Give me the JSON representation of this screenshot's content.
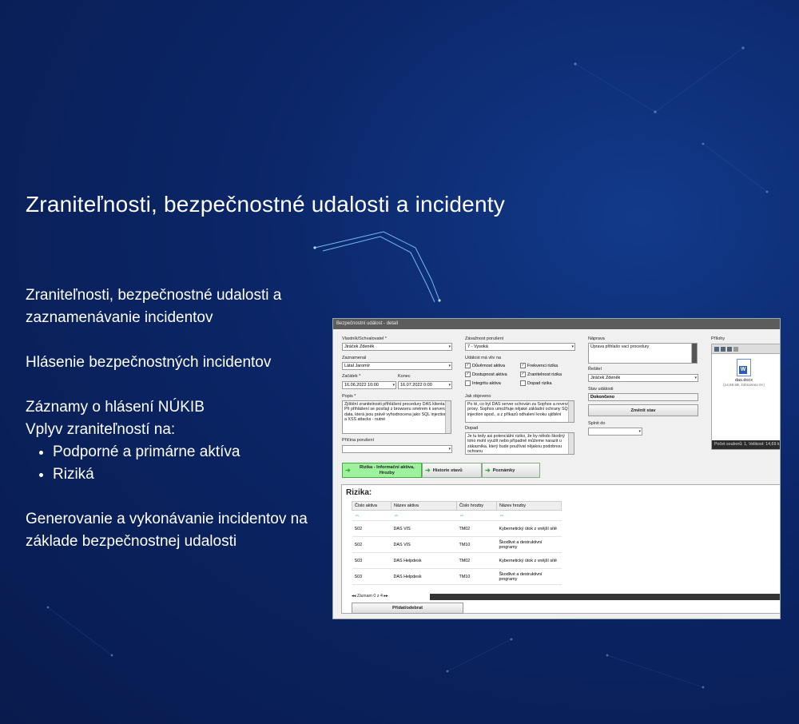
{
  "headline": "Zraniteľnosti, bezpečnostné udalosti a incidenty",
  "bullets": {
    "p1": "Zraniteľnosti, bezpečnostné udalosti a zaznamenávanie incidentov",
    "p2": "Hlásenie bezpečnostných incidentov",
    "p3a": "Záznamy o hlásení NÚKIB",
    "p3b": "Vplyv zraniteľností na:",
    "list": [
      "Podporné a primárne aktíva",
      "Riziká"
    ],
    "p4": "Generovanie a vykonávanie incidentov na základe bezpečnostnej udalosti"
  },
  "screenshot": {
    "window_title": "Bezpečnostní událost - detail",
    "col1": {
      "owner_label": "Vlastník/Schvalovatel *",
      "owner_value": "Jiráček Zdeněk",
      "recorder_label": "Zaznamenal",
      "recorder_value": "Látal Jaromír",
      "start_label": "Začátek *",
      "start_value": "16.06.2022 10:00",
      "end_label": "Konec",
      "end_value": "16.07.2022 0:00",
      "desc_label": "Popis *",
      "desc_text": "Zjištění zranitelnosti přihlášení procedury DAS klienta. Při přihlášení se posílají z browseru směrem k serveru data, která jsou právě vyhodnocena jako SQL injection a XSS attacks - nutné",
      "cause_label": "Příčina porušení",
      "cause_value": ""
    },
    "col2": {
      "severity_label": "Závažnost porušení",
      "severity_value": "7 - Vysoká",
      "impact_label": "Událost má vliv na",
      "checks": [
        {
          "label": "Důvěrnost aktiva",
          "checked": true
        },
        {
          "label": "Frekvenci rizika",
          "checked": true
        },
        {
          "label": "Dostupnost aktiva",
          "checked": true
        },
        {
          "label": "Zranitelnost rizika",
          "checked": true
        },
        {
          "label": "Integritu aktiva",
          "checked": false
        },
        {
          "label": "Dopad rizika",
          "checked": false
        }
      ],
      "found_label": "Jak objeveno",
      "found_text": "Po té, co byl DAS server schován za Sophos a reverzní proxy. Sophos umožňuje nějaké základní ochrany SQL injection apod., a z příkazů odhalení kroku ujištění",
      "impact2_label": "Dopad",
      "impact2_text": "Je tu tedy asi potenciální riziko, že by někdo škodný toho mohl využít nebo případně můžeme narazit u zákazníka, který bude používat nějakou podobnou ochranu"
    },
    "col3": {
      "remedy_label": "Náprava",
      "remedy_text": "Úprava přihlašo vací procedury",
      "solver_label": "Řešitel",
      "solver_value": "Jiráček Zdeněk",
      "state_label": "Stav události",
      "state_value": "Dokončeno",
      "change_state_btn": "Změnit stav",
      "fulfil_label": "Splnit do",
      "fulfil_value": ""
    },
    "attachments": {
      "label": "Přílohy",
      "file_name": "das.docx",
      "file_info": "(14,69 kB, zobrazeno 0×)",
      "footer": "Počet souborů: 1, Velikost: 14,69 kB"
    },
    "tabs": [
      "Rizika - Informační aktiva, Hrozby",
      "Historie stavů",
      "Poznámky"
    ],
    "grid": {
      "title": "Rizika:",
      "headers": [
        "Číslo aktiva",
        "Název aktiva",
        "Číslo hrozby",
        "Název hrozby"
      ],
      "rows": [
        [
          "S02",
          "DAS VIS",
          "TM02",
          "Kybernetický útok z vnější sítě"
        ],
        [
          "S02",
          "DAS VIS",
          "TM10",
          "Škodlivé a destruktivní programy"
        ],
        [
          "S03",
          "DAS Helpdesk",
          "TM02",
          "Kybernetický útok z vnější sítě"
        ],
        [
          "S03",
          "DAS Helpdesk",
          "TM10",
          "Škodlivé a destruktivní programy"
        ]
      ],
      "pager": "Záznam 0 z 4",
      "add_btn": "Přidat/odebrat"
    }
  }
}
